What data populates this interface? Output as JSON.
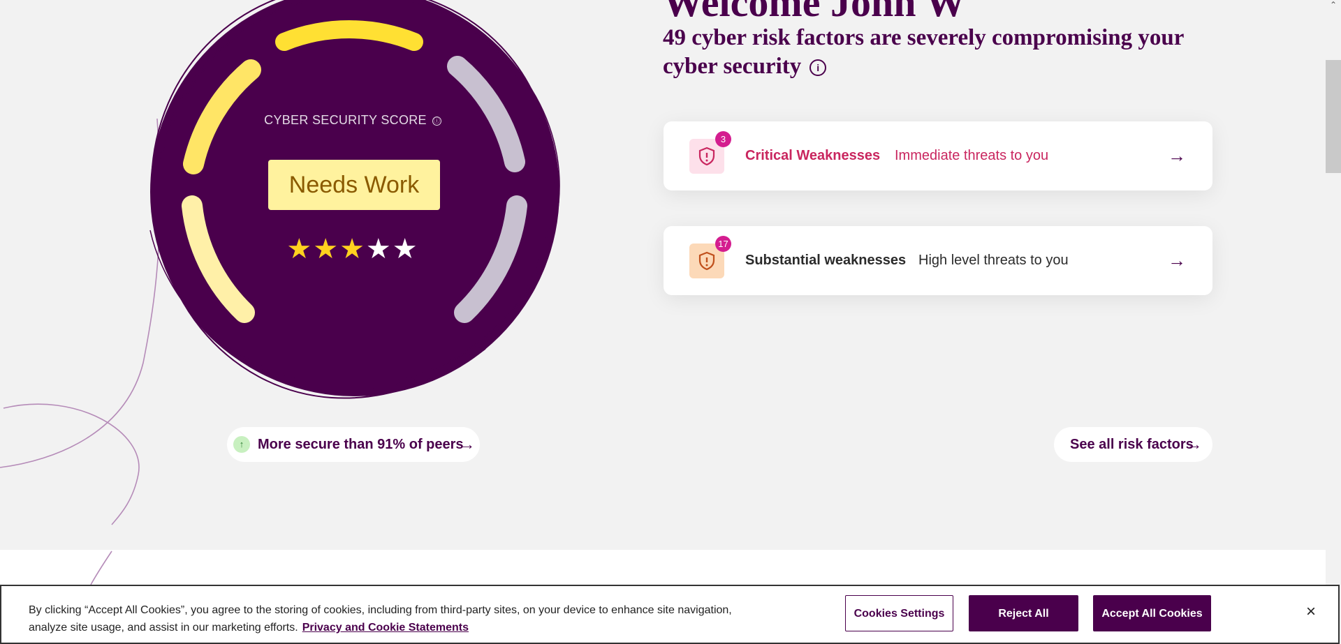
{
  "scrollbar": {
    "up_arrow": "⌃"
  },
  "score": {
    "title": "CYBER SECURITY SCORE",
    "info_icon": "ⓘ",
    "rating_label": "Needs Work",
    "stars_rating": 3,
    "stars_max": 5,
    "star_glyph": "★"
  },
  "header": {
    "welcome": "Welcome John W",
    "subtitle": "49 cyber risk factors are severely compromising your cyber security",
    "info_icon": "i"
  },
  "cards": [
    {
      "count": "3",
      "name": "Critical Weaknesses",
      "description": "Immediate threats to you",
      "icon": "shield-alert-icon",
      "color": "#c9265f",
      "icon_bg": "#fde0ea",
      "arrow": "→"
    },
    {
      "count": "17",
      "name": "Substantial weaknesses",
      "description": "High level threats to you",
      "icon": "shield-alert-icon",
      "color": "#2b2b2b",
      "icon_bg": "#fcd9b8",
      "arrow": "→"
    }
  ],
  "peers": {
    "label": "More secure than 91% of peers",
    "up_icon": "↑",
    "arrow": "→"
  },
  "see_all": {
    "label": "See all risk factors",
    "arrow": "→"
  },
  "cookie_banner": {
    "text": "By clicking “Accept All Cookies”, you agree to the storing of cookies, including from third-party sites, on your device to enhance site navigation, analyze site usage, and assist in our marketing efforts.",
    "link": "Privacy and Cookie Statements",
    "settings": "Cookies Settings",
    "reject": "Reject All",
    "accept": "Accept All Cookies",
    "close": "×"
  },
  "colors": {
    "brand": "#4a004c",
    "accent_yellow": "#ffe033",
    "critical": "#c9265f",
    "badge_pink": "#d41d8f"
  }
}
